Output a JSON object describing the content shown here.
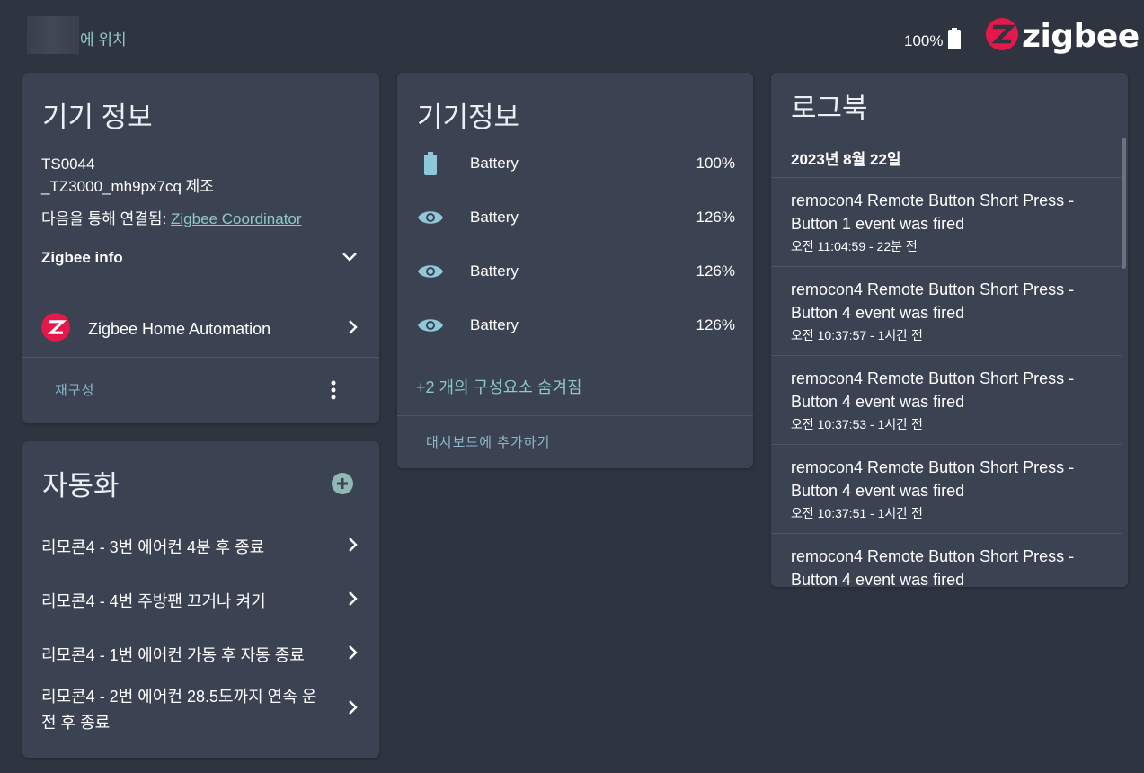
{
  "topbar": {
    "area_suffix": "에 위치",
    "battery": "100%",
    "logo_text": "zigbee"
  },
  "device_card": {
    "title": "기기 정보",
    "model": "TS0044",
    "manufacturer": "_TZ3000_mh9px7cq 제조",
    "connected_prefix": "다음을 통해 연결됨: ",
    "connected_link": "Zigbee Coordinator",
    "zigbee_info": "Zigbee info",
    "integration": "Zigbee Home Automation",
    "reconfigure": "재구성"
  },
  "automation_card": {
    "title": "자동화",
    "items": [
      "리모콘4 - 3번 에어컨 4분 후 종료",
      "리모콘4 - 4번 주방팬 끄거나 켜기",
      "리모콘4 - 1번 에어컨 가동 후 자동 종료",
      "리모콘4 - 2번 에어컨 28.5도까지 연속 운전 후 종료"
    ]
  },
  "entities_card": {
    "title": "기기정보",
    "rows": [
      {
        "icon": "battery-icon",
        "name": "Battery",
        "value": "100%"
      },
      {
        "icon": "eye-icon",
        "name": "Battery",
        "value": "126%"
      },
      {
        "icon": "eye-icon",
        "name": "Battery",
        "value": "126%"
      },
      {
        "icon": "eye-icon",
        "name": "Battery",
        "value": "126%"
      }
    ],
    "hidden_entities": "+2 개의 구성요소 숨겨짐",
    "add_to_dashboard": "대시보드에 추가하기"
  },
  "logbook_card": {
    "title": "로그북",
    "date": "2023년 8월 22일",
    "entries": [
      {
        "msg1": "remocon4 Remote Button Short Press -",
        "msg2": "Button 1 event was fired",
        "time": "오전 11:04:59 - 22분 전"
      },
      {
        "msg1": "remocon4 Remote Button Short Press -",
        "msg2": "Button 4 event was fired",
        "time": "오전 10:37:57 - 1시간 전"
      },
      {
        "msg1": "remocon4 Remote Button Short Press -",
        "msg2": "Button 4 event was fired",
        "time": "오전 10:37:53 - 1시간 전"
      },
      {
        "msg1": "remocon4 Remote Button Short Press -",
        "msg2": "Button 4 event was fired",
        "time": "오전 10:37:51 - 1시간 전"
      },
      {
        "msg1": "remocon4 Remote Button Short Press -",
        "msg2": "Button 4 event was fired",
        "time": ""
      }
    ]
  },
  "colors": {
    "background": "#2e3440",
    "card": "#3b4252",
    "accent": "#8fc9c5",
    "zigbee_red": "#e6174b"
  }
}
